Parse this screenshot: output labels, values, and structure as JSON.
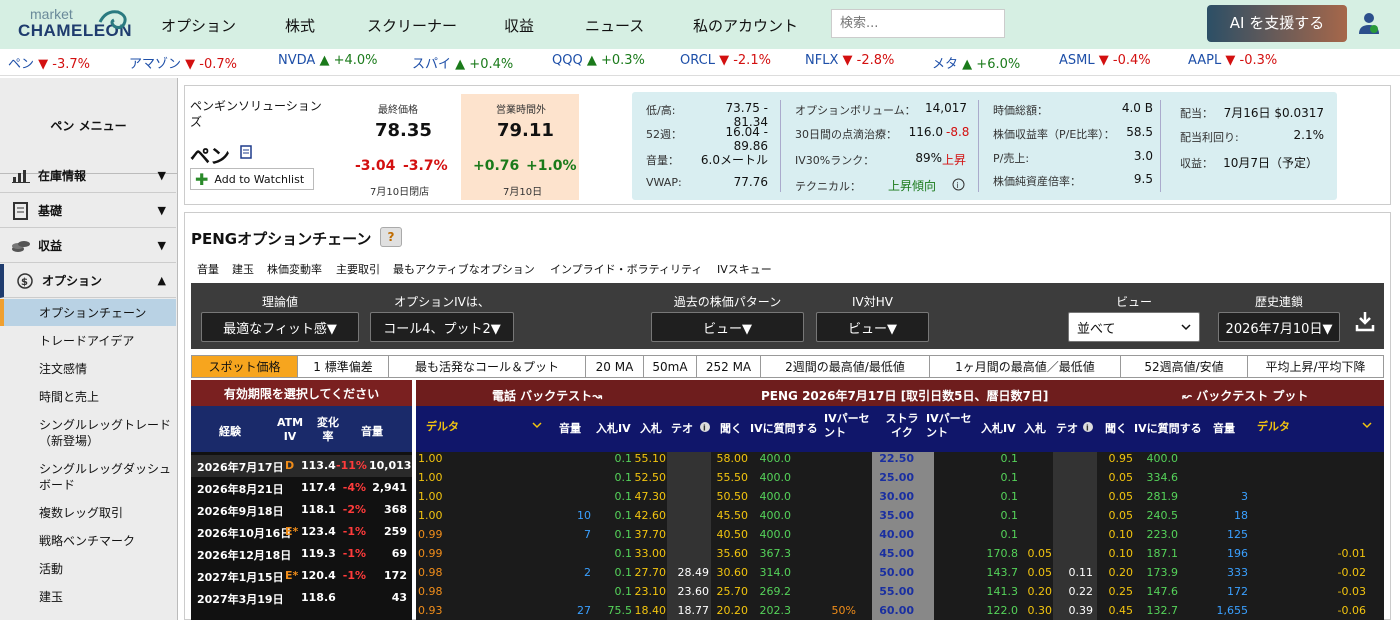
{
  "brand": {
    "line1": "market",
    "line2": "CHAMELEON"
  },
  "nav": [
    "オプション",
    "株式",
    "スクリーナー",
    "収益",
    "ニュース",
    "私のアカウント"
  ],
  "search": {
    "placeholder": "検索..."
  },
  "ai_button": "AI を支援する",
  "ticker": [
    {
      "name": "ペン",
      "dir": "▼",
      "chg": "-3.7%"
    },
    {
      "name": "アマゾン",
      "dir": "▼",
      "chg": "-0.7%"
    },
    {
      "name": "NVDA",
      "dir": "▲",
      "chg": "+4.0%"
    },
    {
      "name": "スパイ",
      "dir": "▲",
      "chg": "+0.4%"
    },
    {
      "name": "QQQ",
      "dir": "▲",
      "chg": "+0.3%"
    },
    {
      "name": "ORCL",
      "dir": "▼",
      "chg": "-2.1%"
    },
    {
      "name": "NFLX",
      "dir": "▼",
      "chg": "-2.8%"
    },
    {
      "name": "メタ",
      "dir": "▲",
      "chg": "+6.0%"
    },
    {
      "name": "ASML",
      "dir": "▼",
      "chg": "-0.4%"
    },
    {
      "name": "AAPL",
      "dir": "▼",
      "chg": "-0.3%"
    }
  ],
  "sidebar": {
    "menu_title": "ペン メニュー",
    "sections": [
      {
        "label": "在庫情報",
        "arrow": "▼",
        "icon": "bar-chart-icon"
      },
      {
        "label": "基礎",
        "arrow": "▼",
        "icon": "document-icon"
      },
      {
        "label": "収益",
        "arrow": "▼",
        "icon": "coins-icon"
      },
      {
        "label": "オプション",
        "arrow": "▲",
        "icon": "dollar-cycle-icon"
      }
    ],
    "sub_items": [
      "オプションチェーン",
      "トレードアイデア",
      "注文感情",
      "時間と売上",
      "シングルレッグトレード（新登場）",
      "シングルレッグダッシュボード",
      "複数レッグ取引",
      "戦略ベンチマーク",
      "活動",
      "建玉"
    ]
  },
  "quote": {
    "company": "ペンギンソリューションズ",
    "symbol": "ペン",
    "watchlist": "Add to Watchlist",
    "last_label": "最終価格",
    "last": "78.35",
    "last_chg": "-3.04",
    "last_pct": "-3.7%",
    "last_date": "7月10日閉店",
    "ah_label": "営業時間外",
    "ah": "79.11",
    "ah_chg": "+0.76",
    "ah_pct": "+1.0%",
    "ah_date": "7月10日"
  },
  "stats": {
    "c1": [
      [
        "低/高:",
        "73.75 - 81.34"
      ],
      [
        "52週：",
        "16.04 - 89.86"
      ],
      [
        "音量：",
        "6.0メートル"
      ],
      [
        "VWAP:",
        "77.76"
      ]
    ],
    "c2": [
      [
        "オプションボリューム：",
        "14,017"
      ],
      [
        "30日間の点滴治療：",
        "116.0"
      ],
      [
        "IV30%ランク：",
        "89%"
      ],
      [
        "テクニカル：",
        "上昇傾向"
      ]
    ],
    "c2_extra": {
      "iv_chg": "-8.8",
      "rank_note": "上昇"
    },
    "c3": [
      [
        "時価総額：",
        "4.0 B"
      ],
      [
        "株価収益率（P/E比率）：",
        "58.5"
      ],
      [
        "P/売上:",
        "3.0"
      ],
      [
        "株価純資産倍率：",
        "9.5"
      ]
    ],
    "c4": [
      [
        "配当：",
        "7月16日 $0.0317"
      ],
      [
        "配当利回り:",
        "2.1%"
      ],
      [
        "収益：",
        "10月7日（予定）"
      ]
    ]
  },
  "chain": {
    "title": "PENGオプションチェーン",
    "help": "?",
    "tabs": [
      "音量",
      "建玉",
      "株価変動率",
      "主要取引",
      "最もアクティブなオプション",
      "インプライド・ボラティリティ",
      "IVスキュー"
    ],
    "controls": {
      "theo_label": "理論値",
      "theo_value": "最適なフィット感▼",
      "iv_label": "オプションIVは、",
      "iv_value": "コール4、プット2▼",
      "pattern_label": "過去の株価パターン",
      "pattern_value": "ビュー▼",
      "ivhv_label": "IV対HV",
      "ivhv_value": "ビュー▼",
      "view_label": "ビュー",
      "view_value": "並べて",
      "hist_label": "歴史連鎖",
      "hist_value": "2026年7月10日▼"
    },
    "filters": [
      "スポット価格",
      "1 標準偏差",
      "最も活発なコール＆プット",
      "20 MA",
      "50mA",
      "252 MA",
      "2週間の最高値/最低値",
      "1ヶ月間の最高値／最低値",
      "52週高値/安値",
      "平均上昇/平均下降"
    ],
    "exp_header": "有効期限を選択してください",
    "exp_cols": [
      "経験",
      "ATM IV",
      "変化率",
      "音量"
    ],
    "expirations": [
      {
        "date": "2026年7月17日",
        "flag": "D",
        "iv": "113.4",
        "chg": "-11%",
        "vol": "10,013"
      },
      {
        "date": "2026年8月21日",
        "flag": "",
        "iv": "117.4",
        "chg": "-4%",
        "vol": "2,941"
      },
      {
        "date": "2026年9月18日",
        "flag": "",
        "iv": "118.1",
        "chg": "-2%",
        "vol": "368"
      },
      {
        "date": "2026年10月16日",
        "flag": "E*",
        "iv": "123.4",
        "chg": "-1%",
        "vol": "259"
      },
      {
        "date": "2026年12月18日",
        "flag": "",
        "iv": "119.3",
        "chg": "-1%",
        "vol": "69"
      },
      {
        "date": "2027年1月15日",
        "flag": "E*",
        "iv": "120.4",
        "chg": "-1%",
        "vol": "172"
      },
      {
        "date": "2027年3月19日",
        "flag": "",
        "iv": "118.6",
        "chg": "",
        "vol": "43"
      }
    ],
    "head_calls": "電話 バックテスト↝",
    "head_mid": "PENG 2026年7月17日 [取引日数5日、暦日数7日]",
    "head_puts": "↜ バックテスト プット",
    "cols": [
      "デルタ",
      "音量",
      "入札IV",
      "入札",
      "テオ",
      "聞く",
      "IVに質問する",
      "IVパーセント",
      "ストライク",
      "IVパーセント",
      "入札IV",
      "入札",
      "テオ",
      "聞く",
      "IVに質問する",
      "音量",
      "デルタ"
    ],
    "rows": [
      {
        "cd": "1.00",
        "cv": "",
        "cbiv": "0.1",
        "cb": "55.10",
        "ct": "",
        "ca": "58.00",
        "caiv": "400.0",
        "cpct": "",
        "k": "22.50",
        "ppct": "",
        "pbiv": "0.1",
        "pb": "",
        "pt": "",
        "pa": "0.95",
        "paiv": "400.0",
        "pv": "",
        "pd": ""
      },
      {
        "cd": "1.00",
        "cv": "",
        "cbiv": "0.1",
        "cb": "52.50",
        "ct": "",
        "ca": "55.50",
        "caiv": "400.0",
        "cpct": "",
        "k": "25.00",
        "ppct": "",
        "pbiv": "0.1",
        "pb": "",
        "pt": "",
        "pa": "0.05",
        "paiv": "334.6",
        "pv": "",
        "pd": ""
      },
      {
        "cd": "1.00",
        "cv": "",
        "cbiv": "0.1",
        "cb": "47.30",
        "ct": "",
        "ca": "50.50",
        "caiv": "400.0",
        "cpct": "",
        "k": "30.00",
        "ppct": "",
        "pbiv": "0.1",
        "pb": "",
        "pt": "",
        "pa": "0.05",
        "paiv": "281.9",
        "pv": "3",
        "pd": ""
      },
      {
        "cd": "1.00",
        "cv": "10",
        "cbiv": "0.1",
        "cb": "42.60",
        "ct": "",
        "ca": "45.50",
        "caiv": "400.0",
        "cpct": "",
        "k": "35.00",
        "ppct": "",
        "pbiv": "0.1",
        "pb": "",
        "pt": "",
        "pa": "0.05",
        "paiv": "240.5",
        "pv": "18",
        "pd": ""
      },
      {
        "cd": "0.99",
        "cv": "7",
        "cbiv": "0.1",
        "cb": "37.70",
        "ct": "",
        "ca": "40.50",
        "caiv": "400.0",
        "cpct": "",
        "k": "40.00",
        "ppct": "",
        "pbiv": "0.1",
        "pb": "",
        "pt": "",
        "pa": "0.10",
        "paiv": "223.0",
        "pv": "125",
        "pd": ""
      },
      {
        "cd": "0.99",
        "cv": "",
        "cbiv": "0.1",
        "cb": "33.00",
        "ct": "",
        "ca": "35.60",
        "caiv": "367.3",
        "cpct": "",
        "k": "45.00",
        "ppct": "",
        "pbiv": "170.8",
        "pb": "0.05",
        "pt": "",
        "pa": "0.10",
        "paiv": "187.1",
        "pv": "196",
        "pd": "-0.01"
      },
      {
        "cd": "0.98",
        "cv": "2",
        "cbiv": "0.1",
        "cb": "27.70",
        "ct": "28.49",
        "ca": "30.60",
        "caiv": "314.0",
        "cpct": "",
        "k": "50.00",
        "ppct": "",
        "pbiv": "143.7",
        "pb": "0.05",
        "pt": "0.11",
        "pa": "0.20",
        "paiv": "173.9",
        "pv": "333",
        "pd": "-0.02"
      },
      {
        "cd": "0.98",
        "cv": "",
        "cbiv": "0.1",
        "cb": "23.10",
        "ct": "23.60",
        "ca": "25.70",
        "caiv": "269.2",
        "cpct": "",
        "k": "55.00",
        "ppct": "",
        "pbiv": "141.3",
        "pb": "0.20",
        "pt": "0.22",
        "pa": "0.25",
        "paiv": "147.6",
        "pv": "172",
        "pd": "-0.03"
      },
      {
        "cd": "0.93",
        "cv": "27",
        "cbiv": "75.5",
        "cb": "18.40",
        "ct": "18.77",
        "ca": "20.20",
        "caiv": "202.3",
        "cpct": "50%",
        "k": "60.00",
        "ppct": "",
        "pbiv": "122.0",
        "pb": "0.30",
        "pt": "0.39",
        "pa": "0.45",
        "paiv": "132.7",
        "pv": "1,655",
        "pd": "-0.06"
      }
    ]
  }
}
